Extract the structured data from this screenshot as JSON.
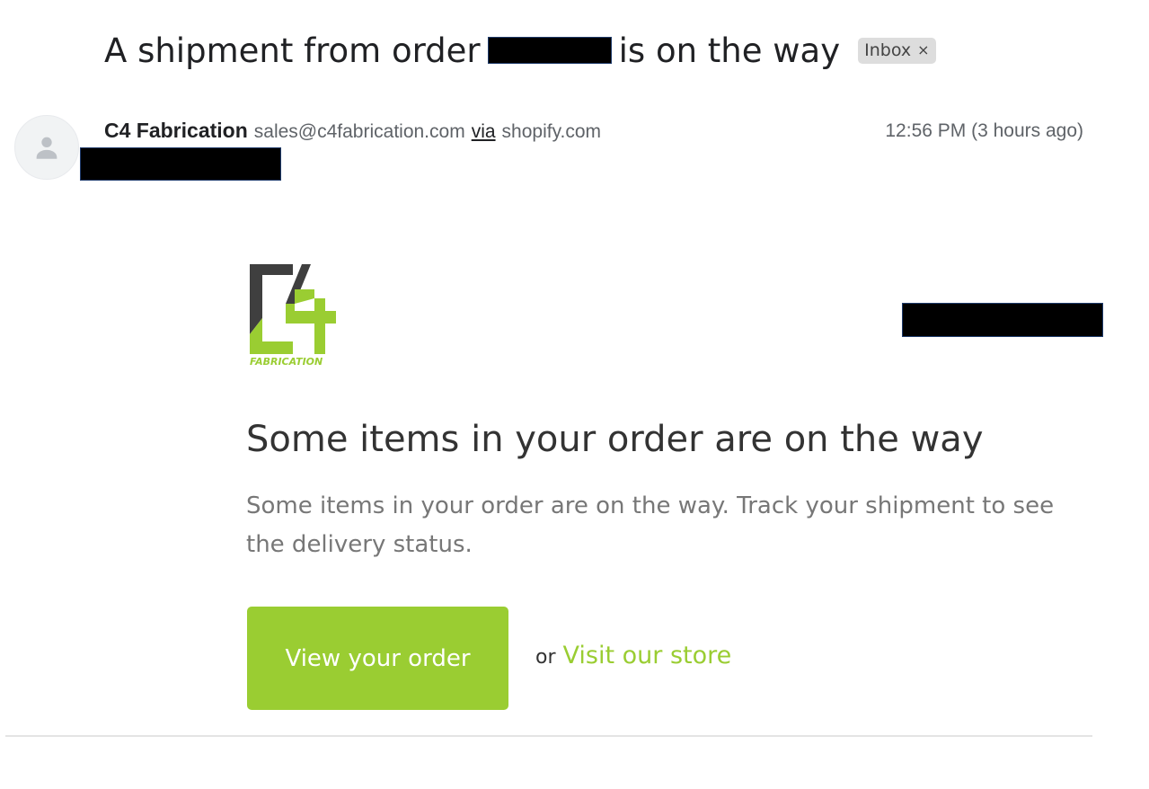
{
  "subject": {
    "before": "A shipment from order",
    "after": "is on the way",
    "label_chip": "Inbox",
    "chip_close": "×"
  },
  "sender": {
    "name": "C4 Fabrication",
    "email": "sales@c4fabrication.com",
    "via": "via",
    "domain": "shopify.com",
    "timestamp": "12:56 PM (3 hours ago)",
    "avatar_icon": "person-icon"
  },
  "email": {
    "logo": {
      "mark": "C4",
      "wordmark": "FABRICATION",
      "dark_color": "#3f3f3f",
      "green_color": "#9acd32"
    },
    "headline": "Some items in your order are on the way",
    "body": "Some items in your order are on the way. Track your shipment to see the delivery status.",
    "button_label": "View your order",
    "or": "or",
    "link_label": "Visit our store"
  },
  "colors": {
    "accent": "#9acd32",
    "redaction": "#000000"
  }
}
